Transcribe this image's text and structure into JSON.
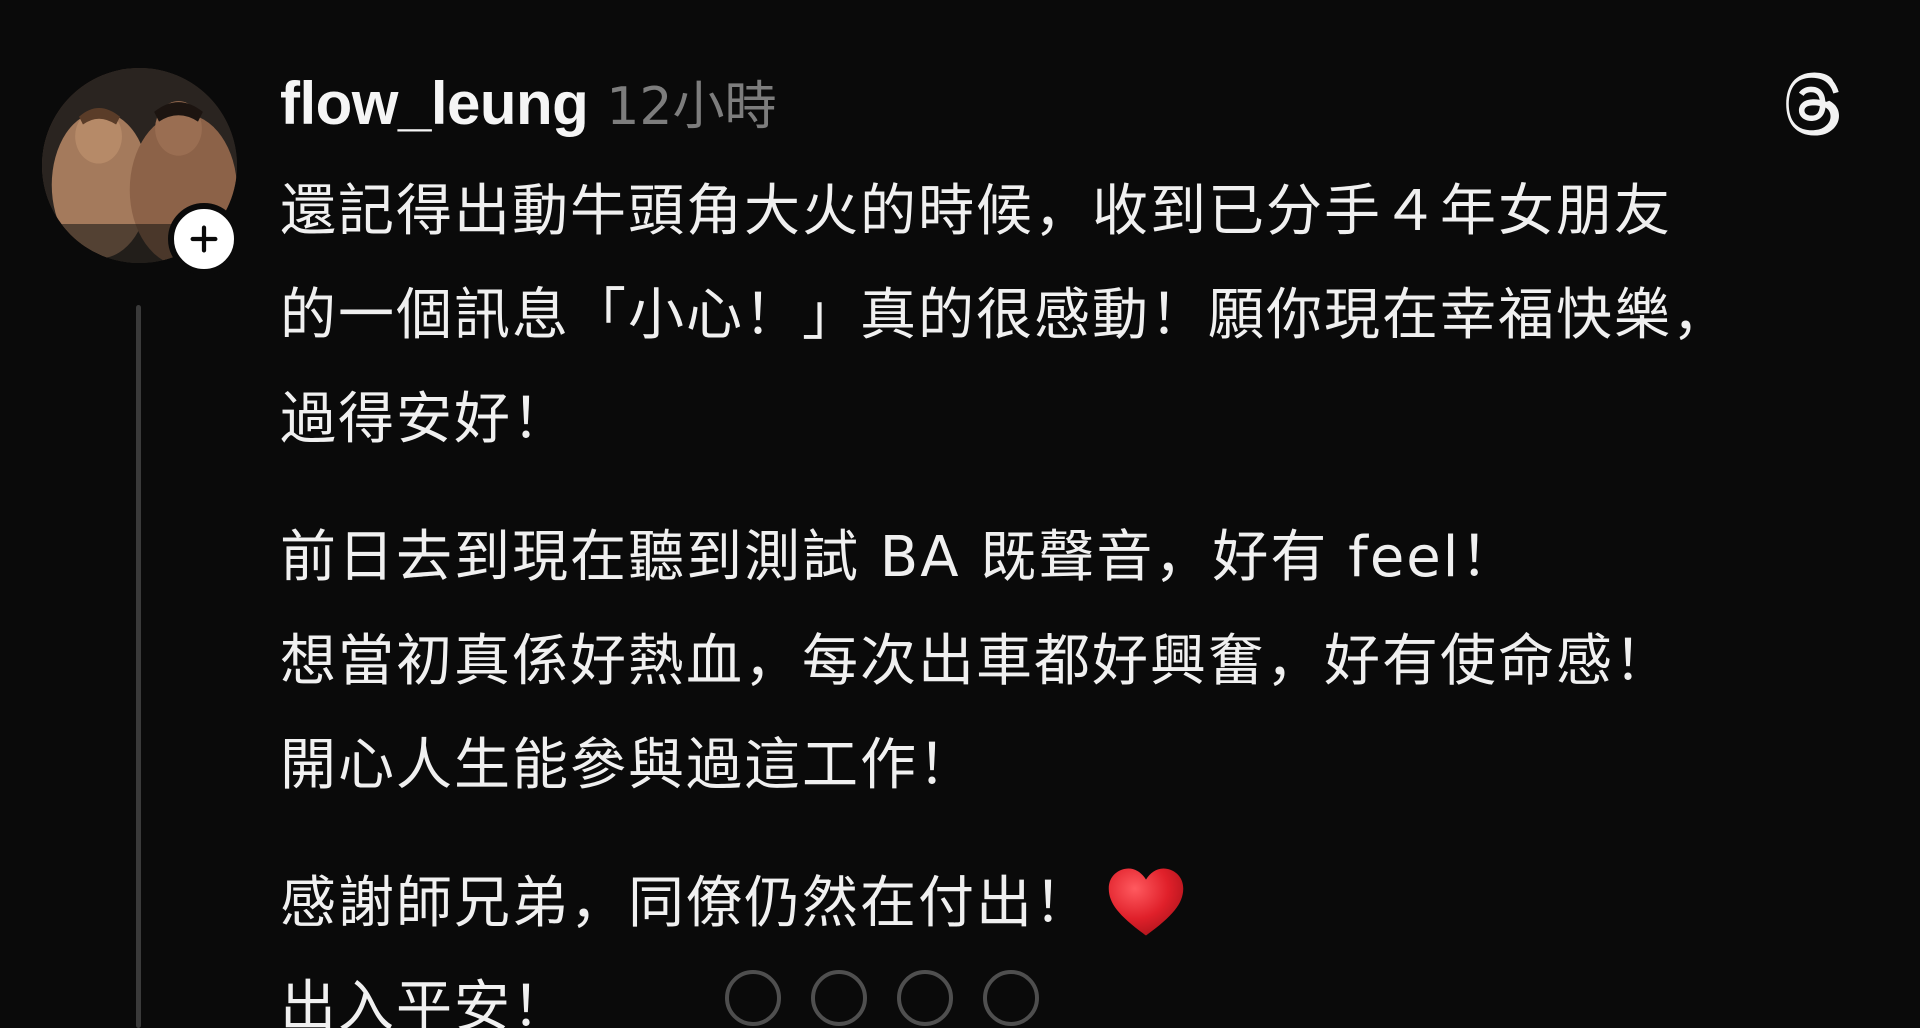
{
  "post": {
    "username": "flow_leung",
    "timestamp": "12小時",
    "lines": [
      "還記得出動牛頭角大火的時候，收到已分手４年女朋友",
      "的一個訊息「小心！」真的很感動！願你現在幸福快樂，",
      "過得安好！",
      "前日去到現在聽到測試 BA 既聲音，好有 feel！",
      "想當初真係好熱血，每次出車都好興奮，好有使命感！",
      "開心人生能參與過這工作！",
      "感謝師兄弟，同僚仍然在付出！",
      "出入平安！"
    ]
  },
  "icons": {
    "avatar": "profile-photo",
    "follow": "plus-icon",
    "brand": "threads-logo-icon",
    "emoji": "red-heart-icon"
  },
  "colors": {
    "background": "#0a0a0a",
    "text": "#f0f0f0",
    "muted": "#7d7d7d",
    "heart": "#e0202a"
  }
}
